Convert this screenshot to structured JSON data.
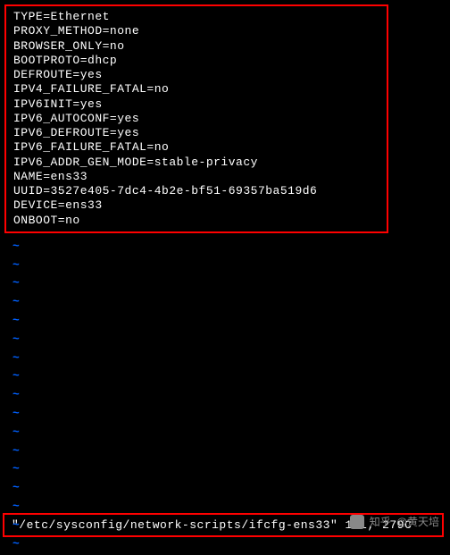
{
  "config": {
    "lines": [
      "TYPE=Ethernet",
      "PROXY_METHOD=none",
      "BROWSER_ONLY=no",
      "BOOTPROTO=dhcp",
      "DEFROUTE=yes",
      "IPV4_FAILURE_FATAL=no",
      "IPV6INIT=yes",
      "IPV6_AUTOCONF=yes",
      "IPV6_DEFROUTE=yes",
      "IPV6_FAILURE_FATAL=no",
      "IPV6_ADDR_GEN_MODE=stable-privacy",
      "NAME=ens33",
      "UUID=3527e405-7dc4-4b2e-bf51-69357ba519d6",
      "DEVICE=ens33",
      "ONBOOT=no"
    ]
  },
  "tildes": {
    "count": 17,
    "char": "~"
  },
  "status": {
    "text": "\"/etc/sysconfig/network-scripts/ifcfg-ens33\" 15L, 279C"
  },
  "watermark": {
    "site": "知乎",
    "author": "@黄天培"
  }
}
